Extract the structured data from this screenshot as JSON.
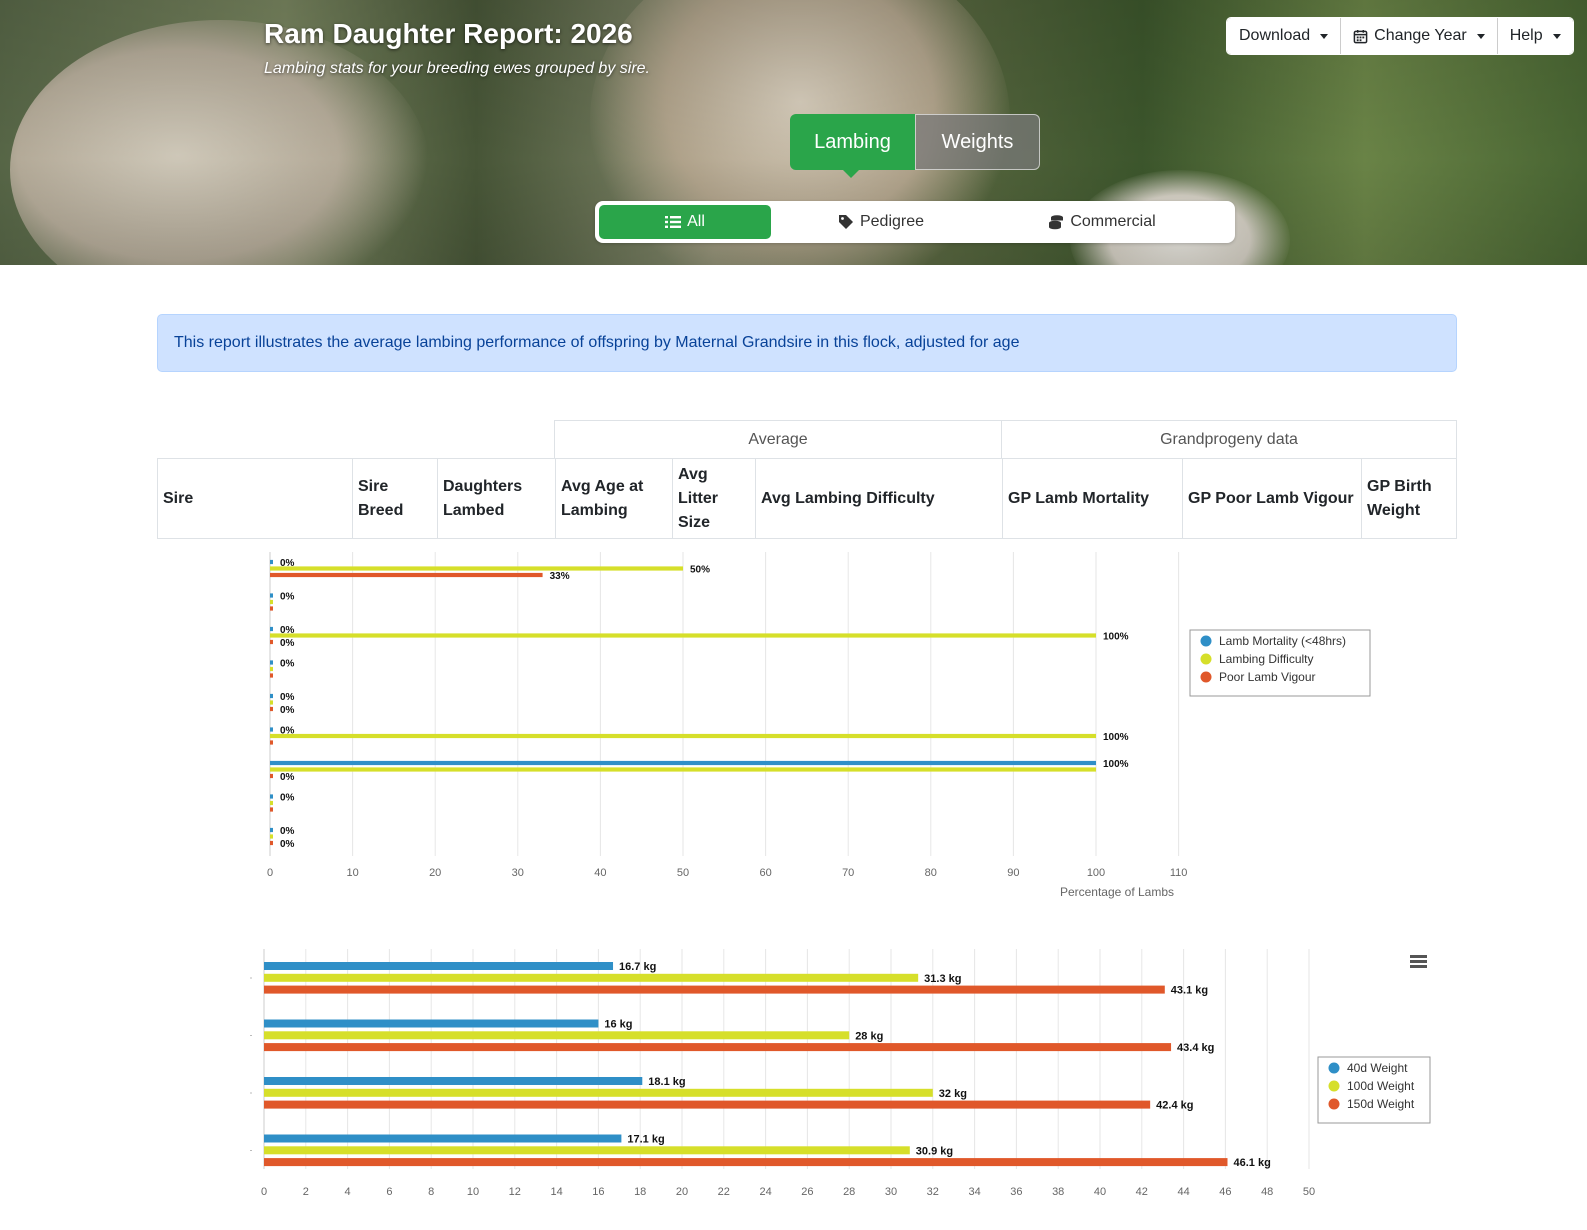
{
  "header": {
    "title": "Ram Daughter Report: 2026",
    "subtitle": "Lambing stats for your breeding ewes grouped by sire.",
    "buttons": {
      "download": "Download",
      "change_year": "Change Year",
      "help": "Help"
    }
  },
  "mode_tabs": {
    "lambing": "Lambing",
    "weights": "Weights",
    "active": "Lambing"
  },
  "filters": {
    "all": "All",
    "pedigree": "Pedigree",
    "commercial": "Commercial",
    "active": "All"
  },
  "alert": {
    "text": "This report illustrates the average lambing performance of offspring by Maternal Grandsire in this flock, adjusted for age"
  },
  "table": {
    "group_headers": {
      "average": "Average",
      "grandprogeny": "Grandprogeny data"
    },
    "columns": [
      "Sire",
      "Sire Breed",
      "Daughters Lambed",
      "Avg Age at Lambing",
      "Avg Litter Size",
      "Avg Lambing Difficulty",
      "GP Lamb Mortality",
      "GP Poor Lamb Vigour",
      "GP Birth Weight"
    ]
  },
  "colors": {
    "blue": "#2f8fc7",
    "yellow": "#d6df2a",
    "orange": "#e0582a",
    "accent_green": "#2aa54a"
  },
  "chart_data": [
    {
      "type": "bar",
      "orientation": "horizontal",
      "xlabel": "Percentage of Lambs",
      "xlim": [
        0,
        110
      ],
      "xticks": [
        0,
        10,
        20,
        30,
        40,
        50,
        60,
        70,
        80,
        90,
        100,
        110
      ],
      "grid": true,
      "legend_position": "right",
      "value_suffix": "%",
      "series": [
        {
          "name": "Lamb Mortality (<48hrs)",
          "color": "#2f8fc7",
          "values": [
            0,
            0,
            0,
            0,
            0,
            0,
            100,
            0,
            0
          ]
        },
        {
          "name": "Lambing Difficulty",
          "color": "#d6df2a",
          "values": [
            50,
            0,
            100,
            0,
            0,
            100,
            100,
            0,
            0
          ]
        },
        {
          "name": "Poor Lamb Vigour",
          "color": "#e0582a",
          "values": [
            33,
            0,
            0,
            0,
            0,
            0,
            0,
            0,
            0
          ]
        }
      ],
      "labels": [
        {
          "row": 0,
          "series": 0,
          "text": "0%"
        },
        {
          "row": 0,
          "series": 1,
          "text": "50%"
        },
        {
          "row": 0,
          "series": 2,
          "text": "33%"
        },
        {
          "row": 1,
          "series": 0,
          "text": "0%"
        },
        {
          "row": 2,
          "series": 0,
          "text": "0%"
        },
        {
          "row": 2,
          "series": 1,
          "text": "100%"
        },
        {
          "row": 2,
          "series": 2,
          "text": "0%"
        },
        {
          "row": 3,
          "series": 0,
          "text": "0%"
        },
        {
          "row": 4,
          "series": 0,
          "text": "0%"
        },
        {
          "row": 4,
          "series": 2,
          "text": "0%"
        },
        {
          "row": 5,
          "series": 0,
          "text": "0%"
        },
        {
          "row": 5,
          "series": 1,
          "text": "100%"
        },
        {
          "row": 6,
          "series": 0,
          "text": "100%"
        },
        {
          "row": 6,
          "series": 2,
          "text": "0%"
        },
        {
          "row": 7,
          "series": 0,
          "text": "0%"
        },
        {
          "row": 8,
          "series": 0,
          "text": "0%"
        },
        {
          "row": 8,
          "series": 2,
          "text": "0%"
        }
      ]
    },
    {
      "type": "bar",
      "orientation": "horizontal",
      "xlim": [
        0,
        50
      ],
      "xticks": [
        0,
        2,
        4,
        6,
        8,
        10,
        12,
        14,
        16,
        18,
        20,
        22,
        24,
        26,
        28,
        30,
        32,
        34,
        36,
        38,
        40,
        42,
        44,
        46,
        48,
        50
      ],
      "grid": true,
      "legend_position": "right",
      "series": [
        {
          "name": "40d Weight",
          "color": "#2f8fc7",
          "values": [
            16.7,
            16,
            18.1,
            17.1
          ],
          "labels": [
            "16.7 kg",
            "16 kg",
            "18.1 kg",
            "17.1 kg"
          ]
        },
        {
          "name": "100d Weight",
          "color": "#d6df2a",
          "values": [
            31.3,
            28,
            32,
            30.9
          ],
          "labels": [
            "31.3 kg",
            "28 kg",
            "32 kg",
            "30.9 kg"
          ]
        },
        {
          "name": "150d Weight",
          "color": "#e0582a",
          "values": [
            43.1,
            43.4,
            42.4,
            46.1
          ],
          "labels": [
            "43.1 kg",
            "43.4 kg",
            "42.4 kg",
            "46.1 kg"
          ]
        }
      ]
    }
  ]
}
